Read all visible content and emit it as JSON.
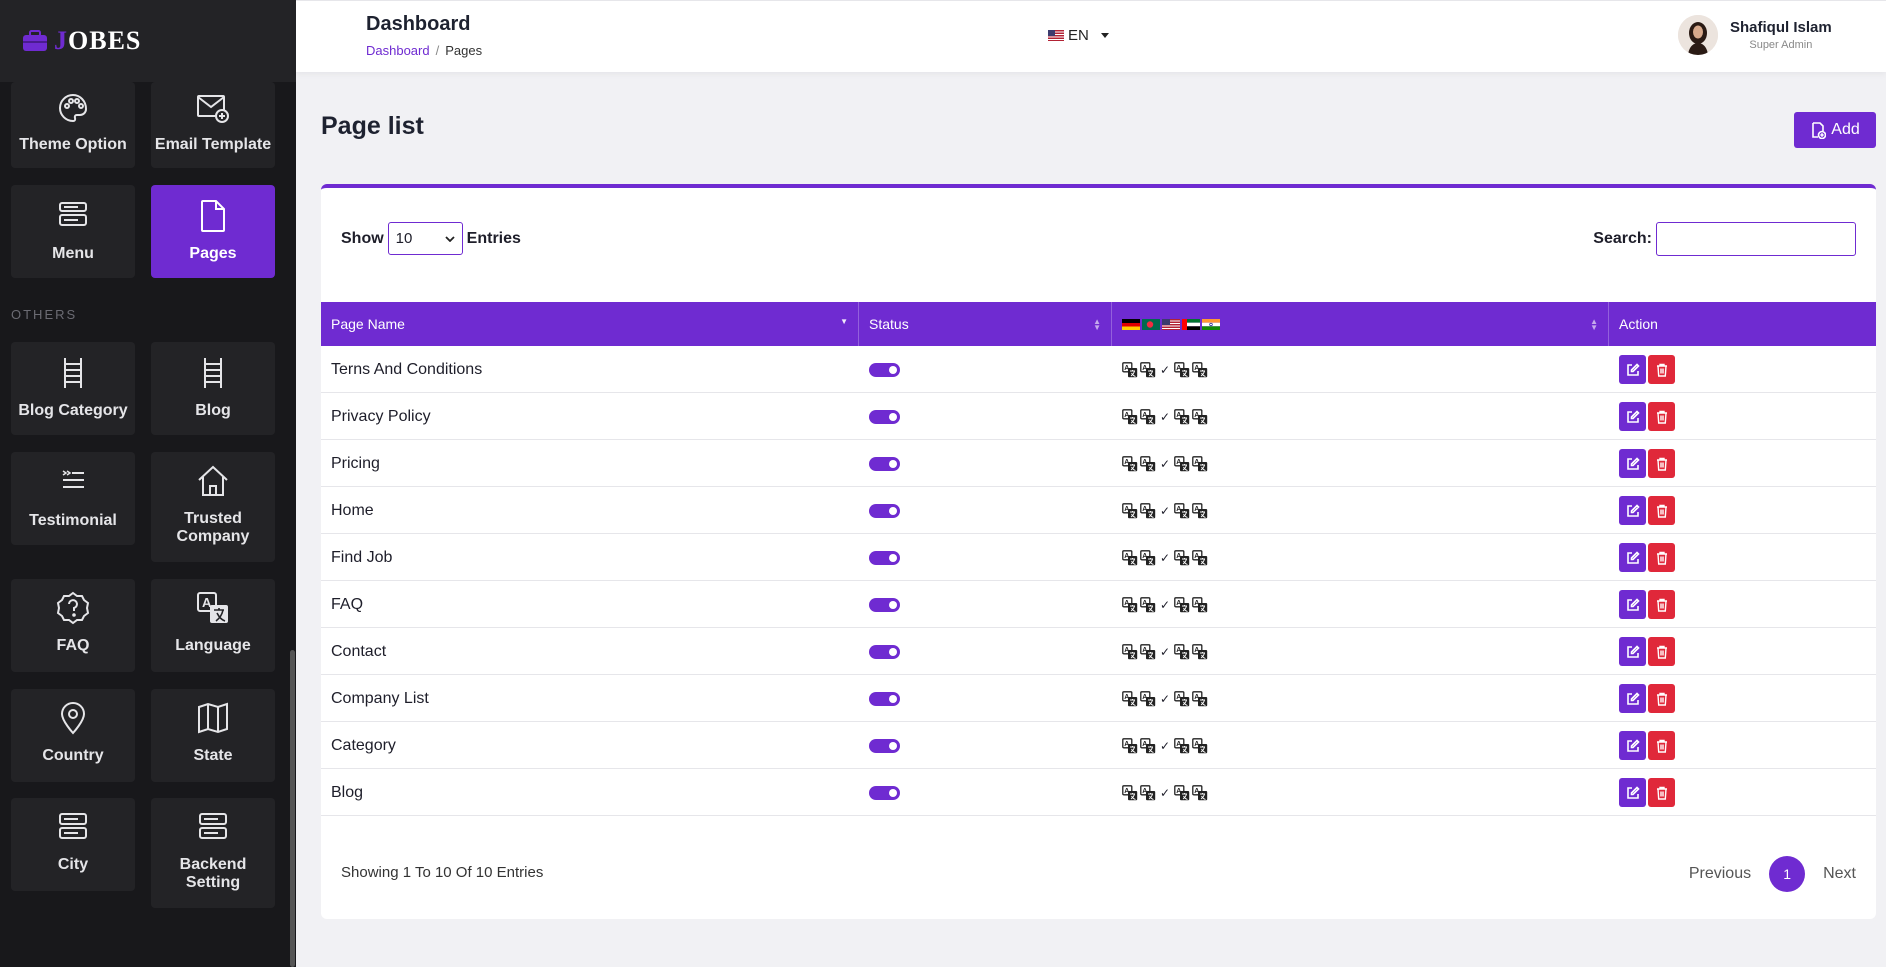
{
  "brand": {
    "name_first": "J",
    "name_rest": "OBES"
  },
  "sidebar": {
    "section_others": "OTHERS",
    "items": [
      {
        "label": "Theme Option",
        "icon": "palette-icon",
        "active": false
      },
      {
        "label": "Email Template",
        "icon": "email-template-icon",
        "active": false
      },
      {
        "label": "Menu",
        "icon": "menu-icon",
        "active": false
      },
      {
        "label": "Pages",
        "icon": "file-icon",
        "active": true
      },
      {
        "label": "Blog Category",
        "icon": "ladder-icon",
        "active": false
      },
      {
        "label": "Blog",
        "icon": "ladder-icon",
        "active": false
      },
      {
        "label": "Testimonial",
        "icon": "quote-list-icon",
        "active": false
      },
      {
        "label": "Trusted Company",
        "icon": "home-icon",
        "active": false
      },
      {
        "label": "FAQ",
        "icon": "question-badge-icon",
        "active": false
      },
      {
        "label": "Language",
        "icon": "translate-icon",
        "active": false
      },
      {
        "label": "Country",
        "icon": "map-pin-icon",
        "active": false
      },
      {
        "label": "State",
        "icon": "map-icon",
        "active": false
      },
      {
        "label": "City",
        "icon": "server-icon",
        "active": false
      },
      {
        "label": "Backend Setting",
        "icon": "server-icon",
        "active": false
      }
    ]
  },
  "header": {
    "title": "Dashboard",
    "breadcrumb": {
      "home": "Dashboard",
      "separator": "/",
      "current": "Pages"
    },
    "language": "EN",
    "user": {
      "name": "Shafiqul Islam",
      "role": "Super Admin"
    }
  },
  "main": {
    "title": "Page list",
    "add_label": "Add",
    "show_label": "Show",
    "entries_value": "10",
    "entries_label": "Entries",
    "search_label": "Search:",
    "search_value": "",
    "columns": {
      "page_name": "Page Name",
      "status": "Status",
      "action": "Action"
    },
    "rows": [
      {
        "name": "Terns And Conditions",
        "status": true
      },
      {
        "name": "Privacy Policy",
        "status": true
      },
      {
        "name": "Pricing",
        "status": true
      },
      {
        "name": "Home",
        "status": true
      },
      {
        "name": "Find Job",
        "status": true
      },
      {
        "name": "FAQ",
        "status": true
      },
      {
        "name": "Contact",
        "status": true
      },
      {
        "name": "Company List",
        "status": true
      },
      {
        "name": "Category",
        "status": true
      },
      {
        "name": "Blog",
        "status": true
      }
    ],
    "footer_info": "Showing 1 To 10 Of 10 Entries",
    "pager": {
      "previous": "Previous",
      "page": "1",
      "next": "Next"
    }
  },
  "colors": {
    "accent": "#6f2bd1",
    "danger": "#e0283a",
    "sidebar_bg": "#18181b",
    "tile_bg": "#232326"
  }
}
